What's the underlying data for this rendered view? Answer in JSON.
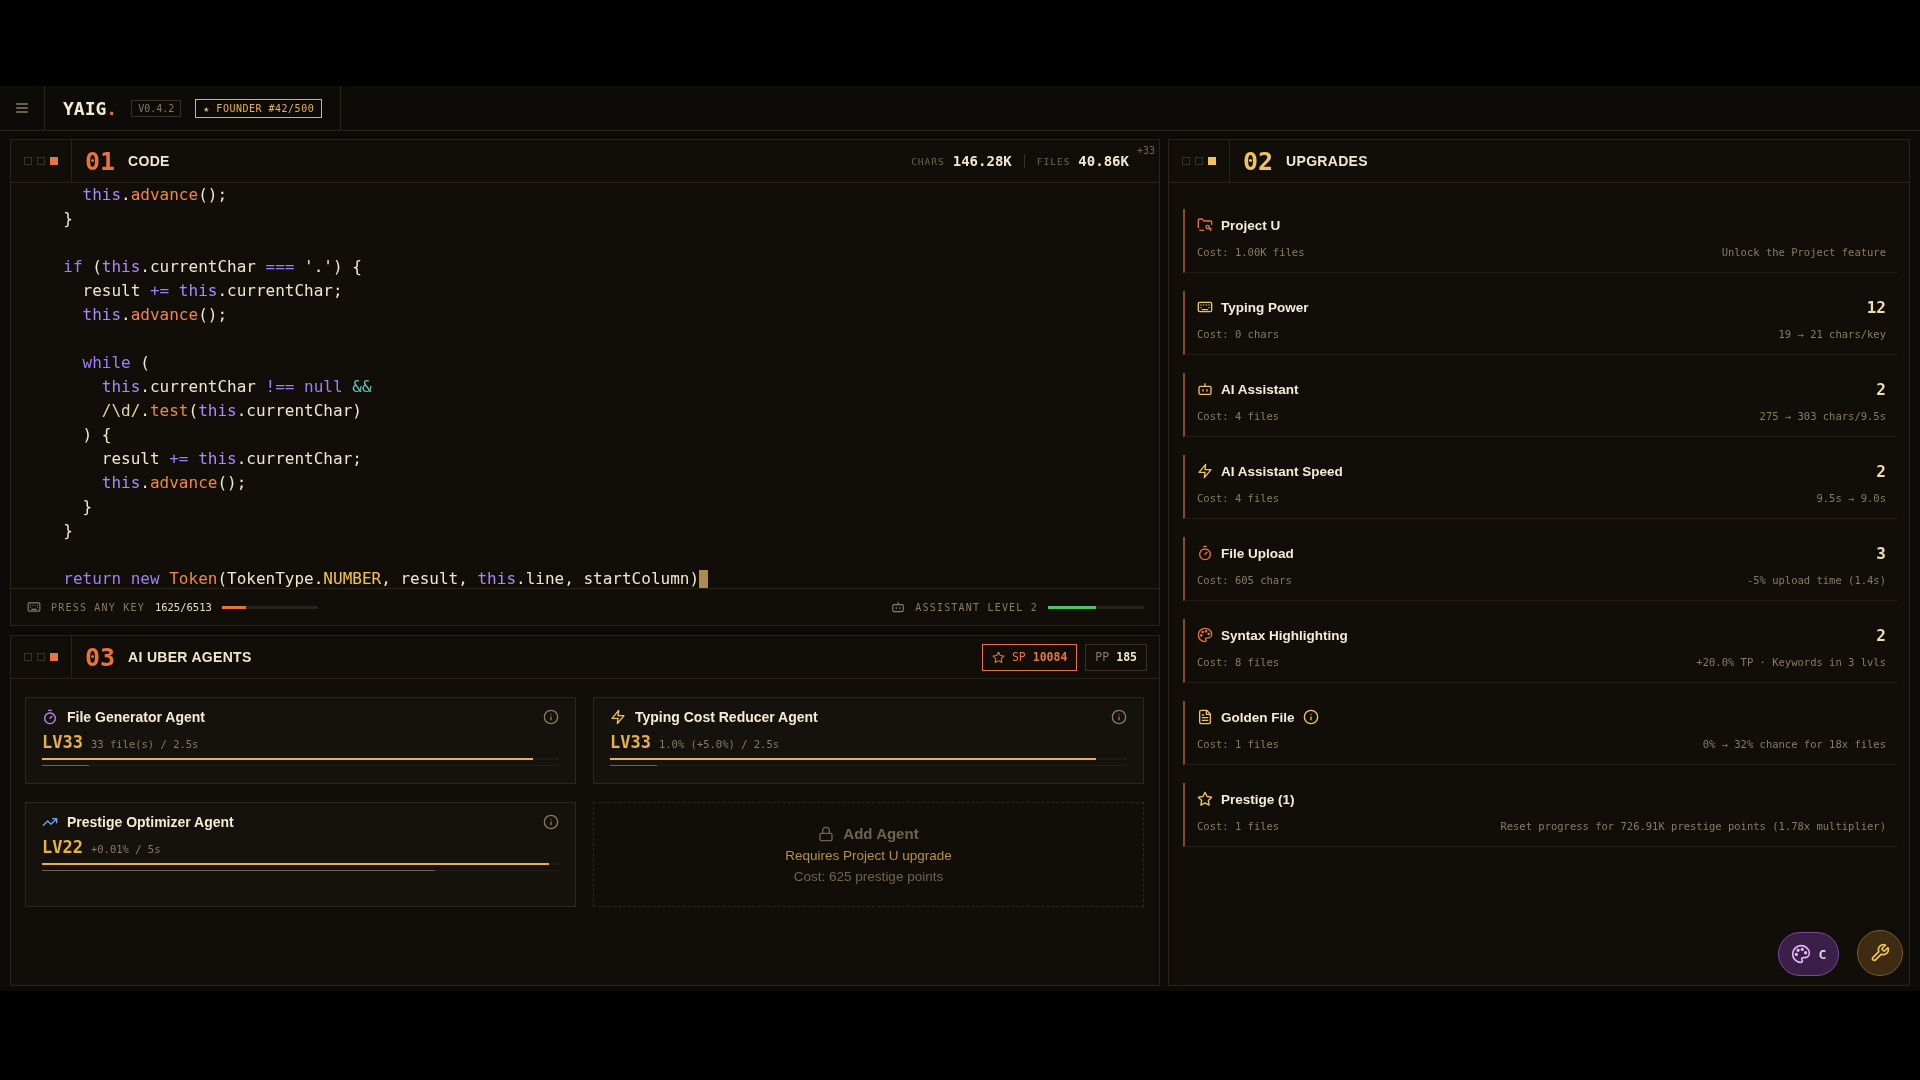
{
  "header": {
    "logo": "YAIG",
    "logo_dot": ".",
    "version": "V0.4.2",
    "badge": "★ FOUNDER #42/500"
  },
  "code_panel": {
    "number": "01",
    "title": "CODE",
    "stats": [
      {
        "label": "CHARS",
        "value": "146.28K"
      },
      {
        "label": "FILES",
        "value": "40.86K"
      }
    ],
    "stat_delta": "+33",
    "lines": [
      {
        "kind": "code",
        "tokens": [
          {
            "t": "    this",
            "kind": "this"
          },
          {
            "t": ".",
            "kind": "plain"
          },
          {
            "t": "advance",
            "kind": "method"
          },
          {
            "t": "();",
            "kind": "plain"
          }
        ]
      },
      {
        "kind": "code",
        "tokens": [
          {
            "t": "  }",
            "kind": "plain"
          }
        ]
      },
      {
        "kind": "blank"
      },
      {
        "kind": "code",
        "tokens": [
          {
            "t": "  if",
            "kind": "keyword"
          },
          {
            "t": " (",
            "kind": "plain"
          },
          {
            "t": "this",
            "kind": "this"
          },
          {
            "t": ".currentChar ",
            "kind": "plain"
          },
          {
            "t": "===",
            "kind": "keyword"
          },
          {
            "t": " '.') {",
            "kind": "plain"
          }
        ]
      },
      {
        "kind": "code",
        "tokens": [
          {
            "t": "    result ",
            "kind": "plain"
          },
          {
            "t": "+=",
            "kind": "keyword"
          },
          {
            "t": " this",
            "kind": "this"
          },
          {
            "t": ".currentChar;",
            "kind": "plain"
          }
        ]
      },
      {
        "kind": "code",
        "tokens": [
          {
            "t": "    this",
            "kind": "this"
          },
          {
            "t": ".",
            "kind": "plain"
          },
          {
            "t": "advance",
            "kind": "method"
          },
          {
            "t": "();",
            "kind": "plain"
          }
        ]
      },
      {
        "kind": "blank"
      },
      {
        "kind": "code",
        "tokens": [
          {
            "t": "    while",
            "kind": "keyword"
          },
          {
            "t": " (",
            "kind": "plain"
          }
        ]
      },
      {
        "kind": "code",
        "tokens": [
          {
            "t": "      this",
            "kind": "this"
          },
          {
            "t": ".currentChar ",
            "kind": "plain"
          },
          {
            "t": "!==",
            "kind": "keyword"
          },
          {
            "t": " null",
            "kind": "keyword"
          },
          {
            "t": " &&",
            "kind": "logic"
          }
        ]
      },
      {
        "kind": "code",
        "tokens": [
          {
            "t": "      /\\d/",
            "kind": "regex"
          },
          {
            "t": ".",
            "kind": "plain"
          },
          {
            "t": "test",
            "kind": "method"
          },
          {
            "t": "(",
            "kind": "plain"
          },
          {
            "t": "this",
            "kind": "this"
          },
          {
            "t": ".currentChar)",
            "kind": "plain"
          }
        ]
      },
      {
        "kind": "code",
        "tokens": [
          {
            "t": "    ) {",
            "kind": "plain"
          }
        ]
      },
      {
        "kind": "code",
        "tokens": [
          {
            "t": "      result ",
            "kind": "plain"
          },
          {
            "t": "+=",
            "kind": "keyword"
          },
          {
            "t": " this",
            "kind": "this"
          },
          {
            "t": ".currentChar;",
            "kind": "plain"
          }
        ]
      },
      {
        "kind": "code",
        "tokens": [
          {
            "t": "      this",
            "kind": "this"
          },
          {
            "t": ".",
            "kind": "plain"
          },
          {
            "t": "advance",
            "kind": "method"
          },
          {
            "t": "();",
            "kind": "plain"
          }
        ]
      },
      {
        "kind": "code",
        "tokens": [
          {
            "t": "    }",
            "kind": "plain"
          }
        ]
      },
      {
        "kind": "code",
        "tokens": [
          {
            "t": "  }",
            "kind": "plain"
          }
        ]
      },
      {
        "kind": "blank"
      },
      {
        "kind": "code",
        "cursor": true,
        "tokens": [
          {
            "t": "  return",
            "kind": "keyword"
          },
          {
            "t": " new",
            "kind": "keyword"
          },
          {
            "t": " Token",
            "kind": "class"
          },
          {
            "t": "(TokenType.",
            "kind": "plain"
          },
          {
            "t": "NUMBER",
            "kind": "const"
          },
          {
            "t": ", result, ",
            "kind": "plain"
          },
          {
            "t": "this",
            "kind": "this"
          },
          {
            "t": ".line, startColumn)",
            "kind": "plain"
          }
        ]
      }
    ],
    "footer": {
      "keys": {
        "label": "PRESS ANY KEY",
        "count": "1625/6513",
        "level": 0.25
      },
      "assistant": {
        "label": "ASSISTANT LEVEL 2",
        "level": 0.5
      }
    }
  },
  "upgrades_panel": {
    "number": "02",
    "title": "UPGRADES",
    "items": [
      {
        "name": "Project U",
        "cost": "Cost: 1.00K files",
        "effect": "Unlock the Project feature"
      },
      {
        "name": "Typing Power",
        "cost": "Cost: 0 chars",
        "level_text": "12",
        "effect": "19 → 21 chars/key"
      },
      {
        "name": "AI Assistant",
        "cost": "Cost: 4 files",
        "level_text": "2",
        "effect": "275 → 303 chars/9.5s"
      },
      {
        "name": "AI Assistant Speed",
        "cost": "Cost: 4 files",
        "level_text": "2",
        "effect": "9.5s → 9.0s"
      },
      {
        "name": "File Upload",
        "cost": "Cost: 605 chars",
        "level_text": "3",
        "effect": "-5% upload time (1.4s)"
      },
      {
        "name": "Syntax Highlighting",
        "cost": "Cost: 8 files",
        "level_text": "2",
        "effect": "+20.0% TP · Keywords in 3 lvls"
      },
      {
        "name": "Golden File",
        "info": true,
        "cost": "Cost: 1 files",
        "effect": "0% → 32% chance for 18x files"
      },
      {
        "name": "Prestige (1)",
        "cost": "Cost: 1 files",
        "effect": "Reset progress for 726.91K prestige points (1.78x multiplier)"
      }
    ]
  },
  "agents_panel": {
    "number": "03",
    "title": "AI UBER AGENTS",
    "sp": {
      "label": "SP",
      "value": "10084"
    },
    "pp": {
      "label": "PP",
      "value": "185"
    },
    "agents": [
      {
        "name": "File Generator Agent",
        "lv": "LV33",
        "detail": "33 file(s) / 2.5s",
        "progress": {
          "level": 0.95
        },
        "cooldown": {
          "level": 0.09
        }
      },
      {
        "name": "Typing Cost Reducer Agent",
        "lv": "LV33",
        "detail": "1.0% (+5.0%) / 2.5s",
        "progress": {
          "level": 0.94
        },
        "cooldown": {
          "level": 0.09
        }
      },
      {
        "name": "Prestige Optimizer Agent",
        "lv": "LV22",
        "detail": "+0.01% / 5s",
        "progress": {
          "level": 0.98
        },
        "cooldown": {
          "level": 0.76
        }
      }
    ],
    "add_agent": {
      "title": "Add Agent",
      "requirement": "Requires Project U upgrade",
      "cost": "Cost: 625 prestige points"
    }
  },
  "fab": {
    "theme_label": "C"
  }
}
